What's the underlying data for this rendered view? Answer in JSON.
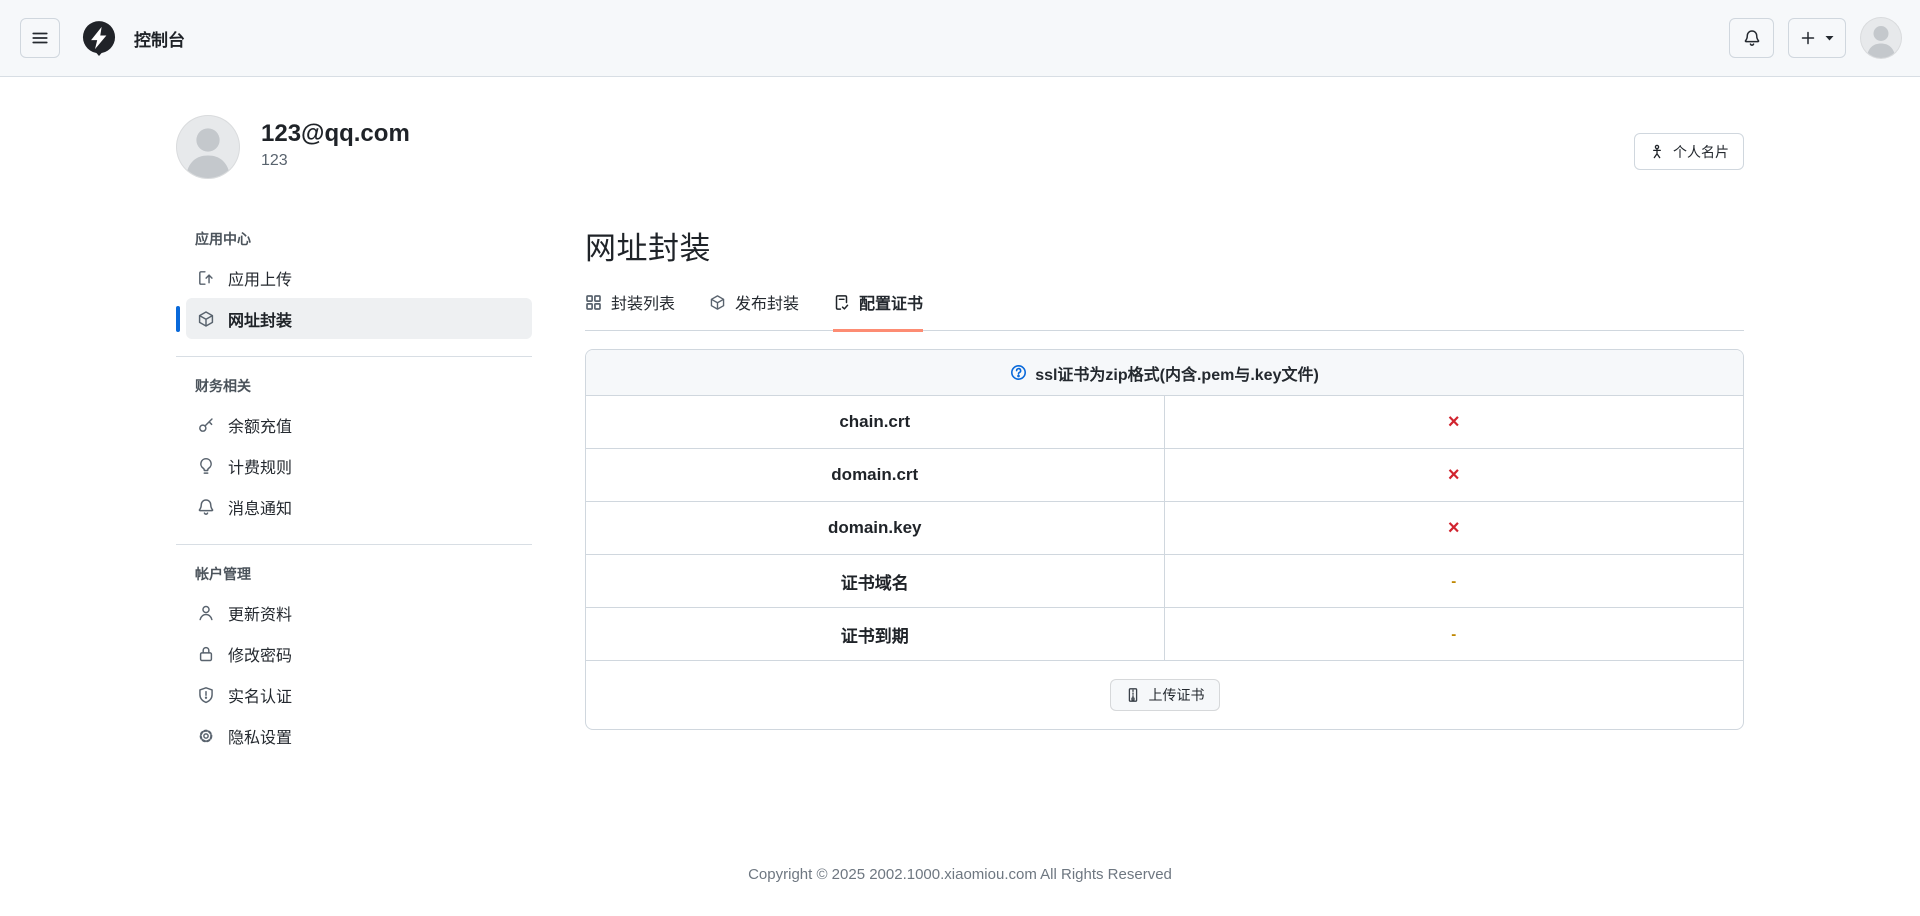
{
  "navbar": {
    "title": "控制台",
    "icons": {
      "menu": "three-bars-icon",
      "logo": "zap-logo-icon",
      "bell": "bell-icon",
      "new": "plus-icon",
      "new_caret": "triangle-down-icon",
      "avatar": "user-avatar"
    }
  },
  "profile": {
    "email": "123@qq.com",
    "username": "123",
    "card_button": {
      "label": "个人名片",
      "icon": "person-card-icon"
    }
  },
  "sidebar": {
    "sections": [
      {
        "label": "应用中心",
        "items": [
          {
            "label": "应用上传",
            "icon": "app-upload-icon",
            "active": false
          },
          {
            "label": "网址封装",
            "icon": "package-icon",
            "active": true
          }
        ]
      },
      {
        "label": "财务相关",
        "items": [
          {
            "label": "余额充值",
            "icon": "key-icon",
            "active": false
          },
          {
            "label": "计费规则",
            "icon": "lightbulb-icon",
            "active": false
          },
          {
            "label": "消息通知",
            "icon": "bell-icon",
            "active": false
          }
        ]
      },
      {
        "label": "帐户管理",
        "items": [
          {
            "label": "更新资料",
            "icon": "person-icon",
            "active": false
          },
          {
            "label": "修改密码",
            "icon": "lock-icon",
            "active": false
          },
          {
            "label": "实名认证",
            "icon": "shield-icon",
            "active": false
          },
          {
            "label": "隐私设置",
            "icon": "gear-icon",
            "active": false
          }
        ]
      }
    ]
  },
  "main": {
    "title": "网址封装",
    "tabs": [
      {
        "label": "封装列表",
        "icon": "apps-icon",
        "active": false
      },
      {
        "label": "发布封装",
        "icon": "package-icon",
        "active": false
      },
      {
        "label": "配置证书",
        "icon": "file-check-icon",
        "active": true
      }
    ],
    "cert_table": {
      "notice": "ssl证书为zip格式(内含.pem与.key文件)",
      "notice_icon": "question-circle-icon",
      "rows": [
        {
          "label": "chain.crt",
          "value": "×",
          "state": "missing"
        },
        {
          "label": "domain.crt",
          "value": "×",
          "state": "missing"
        },
        {
          "label": "domain.key",
          "value": "×",
          "state": "missing"
        },
        {
          "label": "证书域名",
          "value": "-",
          "state": "empty"
        },
        {
          "label": "证书到期",
          "value": "-",
          "state": "empty"
        }
      ],
      "upload_button": {
        "label": "上传证书",
        "icon": "zip-file-icon"
      }
    }
  },
  "footer": {
    "copyright": "Copyright © 2025 2002.1000.xiaomiou.com All Rights Reserved"
  },
  "colors": {
    "accent_blue": "#0969da",
    "danger_red": "#d1242f",
    "warning_gold": "#bf8700",
    "tab_underline": "#fd8c73",
    "navbar_bg": "#f6f8fa",
    "border": "#d0d7de"
  }
}
